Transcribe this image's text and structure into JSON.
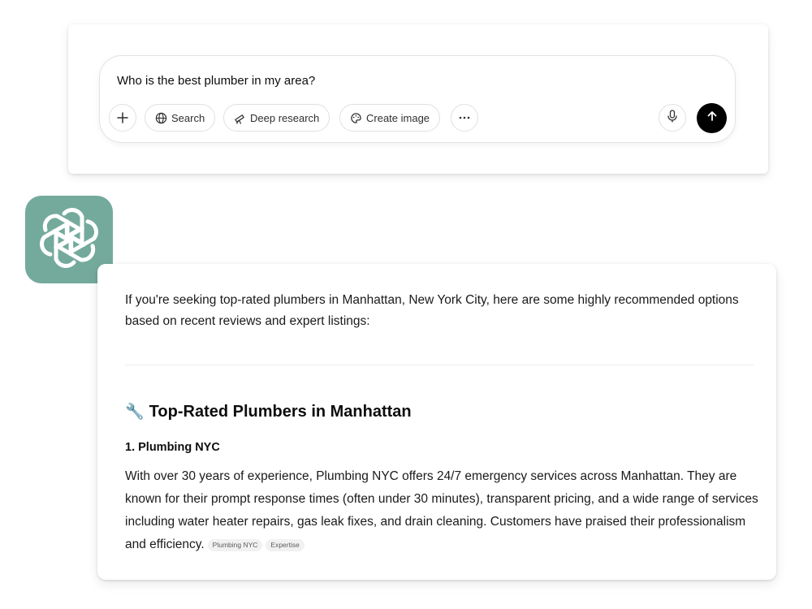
{
  "composer": {
    "text": "Who is the best plumber in my area?",
    "buttons": {
      "search": "Search",
      "deep_research": "Deep research",
      "create_image": "Create image"
    }
  },
  "response": {
    "intro": "If you're seeking top-rated plumbers in Manhattan, New York City, here are some highly recommended options based on recent reviews and expert listings:",
    "section_icon": "🔧",
    "section_title": "Top-Rated Plumbers in Manhattan",
    "items": [
      {
        "title": "1. Plumbing NYC",
        "body": "With over 30 years of experience, Plumbing NYC offers 24/7 emergency services across Manhattan. They are known for their prompt response times (often under 30 minutes), transparent pricing, and a wide range of services including water heater repairs, gas leak fixes, and drain cleaning. Customers have praised their professionalism and efficiency.",
        "sources": [
          "Plumbing NYC",
          "Expertise"
        ]
      }
    ]
  },
  "colors": {
    "logo_bg": "#74aa9c",
    "send_button": "#000000"
  }
}
